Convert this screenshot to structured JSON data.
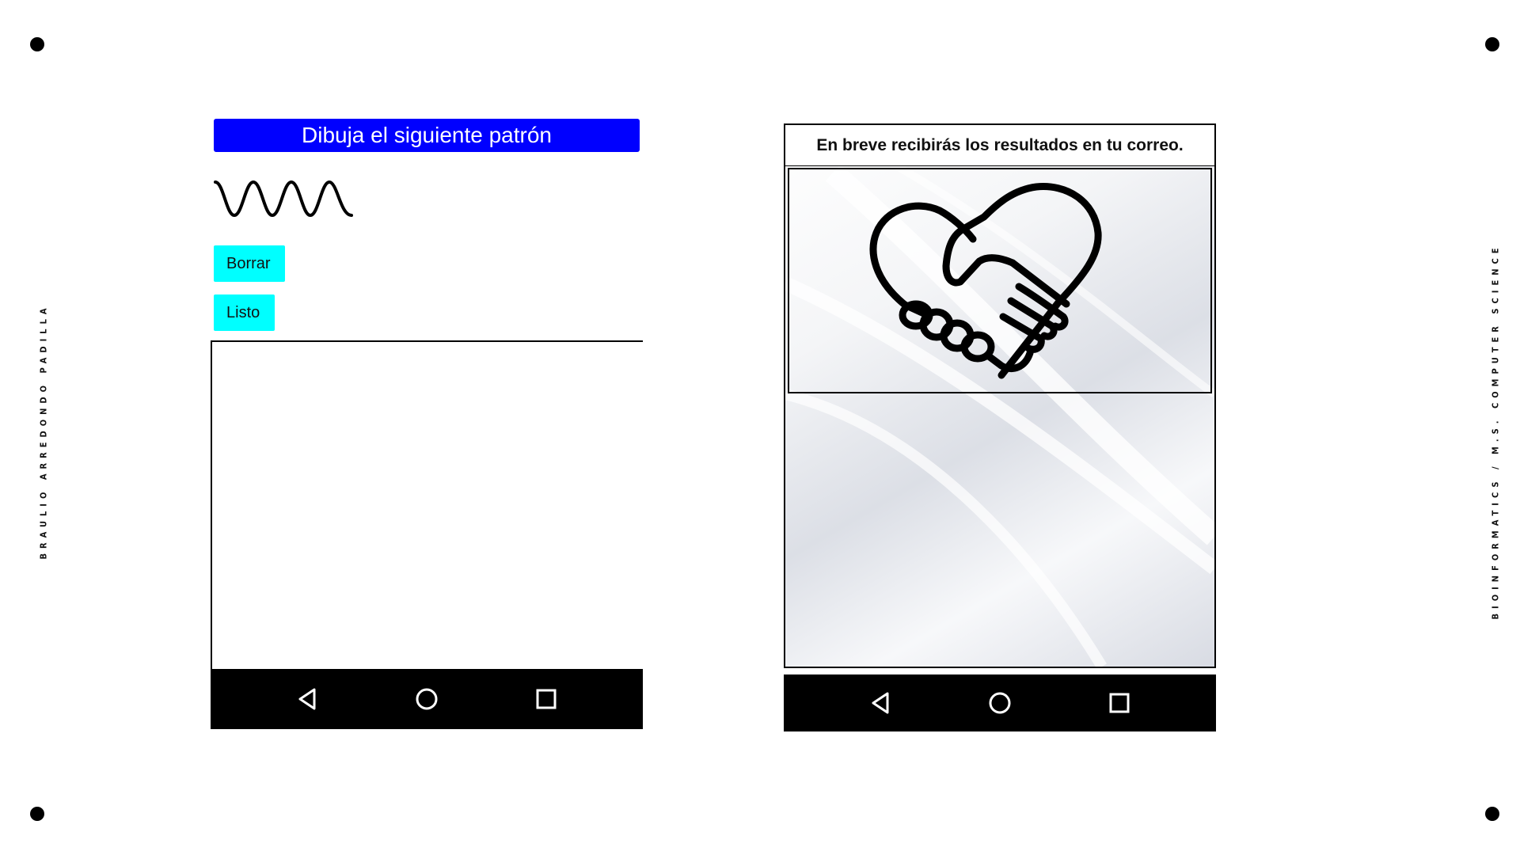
{
  "left_side_text": "BRAULIO ARREDONDO PADILLA",
  "right_side_text": "BIOINFORMATICS / M.S. COMPUTER SCIENCE",
  "left_screen": {
    "title": "Dibuja el siguiente patrón",
    "pattern_icon": "sine-wave-icon",
    "buttons": {
      "clear_label": "Borrar",
      "done_label": "Listo"
    },
    "navbar": [
      "back-icon",
      "home-icon",
      "recents-icon"
    ]
  },
  "right_screen": {
    "message": "En breve recibirás los resultados en tu correo.",
    "illustration_icon": "handshake-heart-icon",
    "navbar": [
      "back-icon",
      "home-icon",
      "recents-icon"
    ]
  },
  "colors": {
    "title_bar": "#0000ff",
    "buttons": "#00ffff",
    "navbar": "#000000"
  }
}
